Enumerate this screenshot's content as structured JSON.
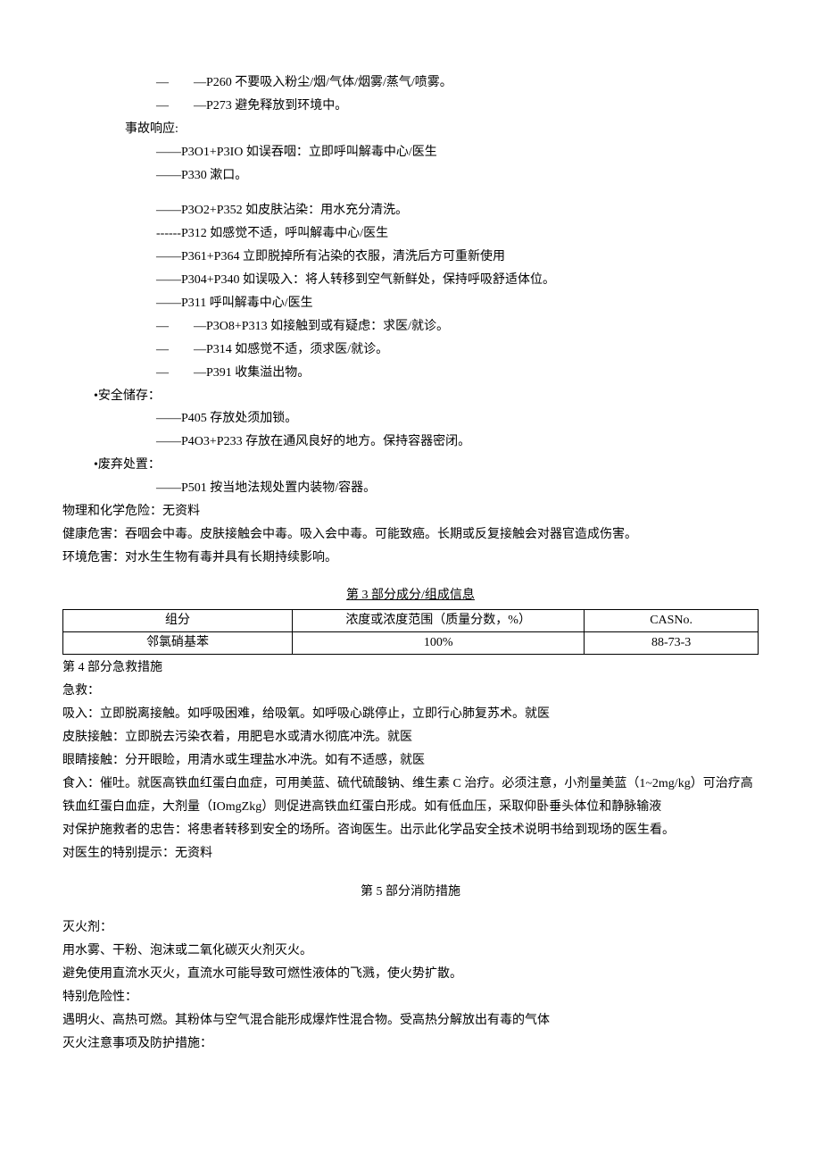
{
  "lines": {
    "l1": "—　　—P260 不要吸入粉尘/烟/气体/烟雾/蒸气/喷雾。",
    "l2": "—　　—P273 避免释放到环境中。",
    "l3": "事故响应:",
    "l4": "——P3O1+P3IO 如误吞咽：立即呼叫解毒中心/医生",
    "l5": "——P330 漱口。",
    "l6": "——P3O2+P352 如皮肤沾染：用水充分清洗。",
    "l7": "------P312 如感觉不适，呼叫解毒中心/医生",
    "l8": "——P361+P364 立即脱掉所有沾染的衣服，清洗后方可重新使用",
    "l9": "——P304+P340 如误吸入：将人转移到空气新鲜处，保持呼吸舒适体位。",
    "l10": "——P311 呼叫解毒中心/医生",
    "l11": "—　　—P3O8+P313 如接触到或有疑虑：求医/就诊。",
    "l12": "—　　—P314 如感觉不适，须求医/就诊。",
    "l13": "—　　—P391 收集溢出物。",
    "l14": "•安全储存：",
    "l15": "——P405 存放处须加锁。",
    "l16": "——P4O3+P233 存放在通风良好的地方。保持容器密闭。",
    "l17": "•废弃处置：",
    "l18": "——P501 按当地法规处置内装物/容器。",
    "l19": "物理和化学危险：无资料",
    "l20": "健康危害：吞咽会中毒。皮肤接触会中毒。吸入会中毒。可能致癌。长期或反复接触会对器官造成伤害。",
    "l21": "环境危害：对水生生物有毒并具有长期持续影响。"
  },
  "section3": {
    "title": "第 3 部分成分/组成信息",
    "table": {
      "h1": "组分",
      "h2": "浓度或浓度范围（质量分数，%）",
      "h3": "CASNo.",
      "c1": "邻氯硝基苯",
      "c2": "100%",
      "c3": "88-73-3"
    }
  },
  "section4": {
    "title": "第 4 部分急救措施",
    "p1": "急救：",
    "p2": "吸入：立即脱离接触。如呼吸困难，给吸氧。如呼吸心跳停止，立即行心肺复苏术。就医",
    "p3": "皮肤接触：立即脱去污染衣着，用肥皂水或清水彻底冲洗。就医",
    "p4": "眼睛接触：分开眼睑，用清水或生理盐水冲洗。如有不适感，就医",
    "p5": "食入：催吐。就医高铁血红蛋白血症，可用美蓝、硫代硫酸钠、维生素 C 治疗。必须注意，小剂量美蓝（1~2mg/kg）可治疗高铁血红蛋白血症，大剂量（IOmgZkg）则促进高铁血红蛋白形成。如有低血压，采取仰卧垂头体位和静脉输液",
    "p6": "对保护施救者的忠告：将患者转移到安全的场所。咨询医生。出示此化学品安全技术说明书给到现场的医生看。",
    "p7": "对医生的特别提示：无资料"
  },
  "section5": {
    "title": "第 5 部分消防措施",
    "p1": "灭火剂：",
    "p2": "用水雾、干粉、泡沫或二氧化碳灭火剂灭火。",
    "p3": "避免使用直流水灭火，直流水可能导致可燃性液体的飞溅，使火势扩散。",
    "p4": "特别危险性：",
    "p5": "遇明火、高热可燃。其粉体与空气混合能形成爆炸性混合物。受高热分解放出有毒的气体",
    "p6": "灭火注意事项及防护措施："
  }
}
